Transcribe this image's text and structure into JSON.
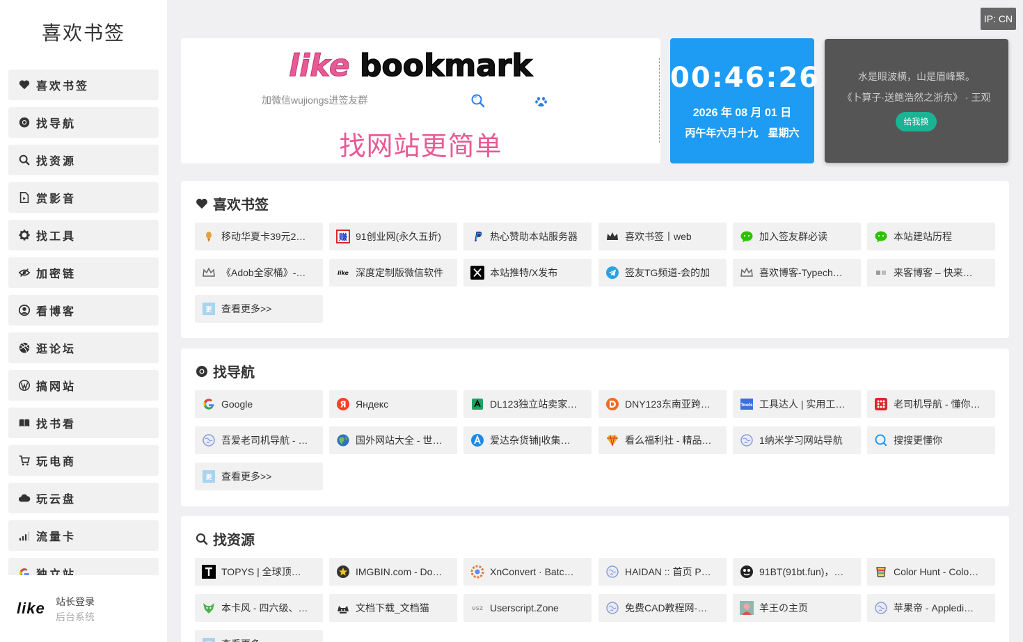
{
  "site": {
    "title": "喜欢书签",
    "logo_text": "likebookmark",
    "slogan": "找网站更简单"
  },
  "ip_badge": "IP: CN",
  "search": {
    "placeholder": "加微信wujiongs进签友群"
  },
  "clock": {
    "time": "00:46:26",
    "date": "2026 年 08 月 01 日",
    "lunar": "丙午年六月十九 星期六"
  },
  "poem": {
    "line": "水是眼波横，山是眉峰聚。",
    "source": "《卜算子·送鲍浩然之浙东》 · 王观",
    "button": "给我换"
  },
  "sidebar": {
    "items": [
      {
        "label": "喜欢书签",
        "icon": "heart-icon"
      },
      {
        "label": "找导航",
        "icon": "chrome-icon"
      },
      {
        "label": "找资源",
        "icon": "search-icon"
      },
      {
        "label": "赏影音",
        "icon": "video-file-icon"
      },
      {
        "label": "找工具",
        "icon": "gear-icon"
      },
      {
        "label": "加密链",
        "icon": "eye-slash-icon"
      },
      {
        "label": "看博客",
        "icon": "user-circle-icon"
      },
      {
        "label": "逛论坛",
        "icon": "dribbble-icon"
      },
      {
        "label": "搞网站",
        "icon": "wordpress-icon"
      },
      {
        "label": "找书看",
        "icon": "book-icon"
      },
      {
        "label": "玩电商",
        "icon": "cart-icon"
      },
      {
        "label": "玩云盘",
        "icon": "cloud-icon"
      },
      {
        "label": "流量卡",
        "icon": "signal-icon"
      },
      {
        "label": "独立站",
        "icon": "google-icon"
      }
    ],
    "footer": {
      "logo": "like",
      "login": "站长登录",
      "admin": "后台系统"
    }
  },
  "sections": [
    {
      "title": "喜欢书签",
      "icon": "heart-icon",
      "links": [
        {
          "label": "移动华夏卡39元2…",
          "icon": "gold-icon",
          "color": "#e8a23a"
        },
        {
          "label": "91创业网(永久五折)",
          "icon": "zhuan-icon",
          "color": "#d9262c"
        },
        {
          "label": "热心赞助本站服务器",
          "icon": "paypal-icon",
          "color": "#1f3c88"
        },
        {
          "label": "喜欢书签丨web",
          "icon": "crown-icon",
          "color": "#333333"
        },
        {
          "label": "加入签友群必读",
          "icon": "wechat-icon",
          "color": "#2dc100"
        },
        {
          "label": "本站建站历程",
          "icon": "wechat-icon",
          "color": "#2dc100"
        },
        {
          "label": "《Adob全家桶》-…",
          "icon": "crown-outline-icon",
          "color": "#666666"
        },
        {
          "label": "深度定制版微信软件",
          "icon": "like-icon",
          "color": "#111111"
        },
        {
          "label": "本站推特/X发布",
          "icon": "x-icon",
          "color": "#000000"
        },
        {
          "label": "签友TG频道-会的加",
          "icon": "telegram-icon",
          "color": "#2aa3e0"
        },
        {
          "label": "喜欢博客-Typech…",
          "icon": "crown-outline-icon",
          "color": "#666666"
        },
        {
          "label": "来客博客 – 快来…",
          "icon": "blog-icon",
          "color": "#999999"
        },
        {
          "label": "查看更多>>",
          "icon": "more-icon",
          "color": "#a8d4f0"
        }
      ]
    },
    {
      "title": "找导航",
      "icon": "chrome-icon",
      "links": [
        {
          "label": "Google",
          "icon": "google-icon",
          "color": "#4285f4"
        },
        {
          "label": "Яндекс",
          "icon": "yandex-icon",
          "color": "#fc3f1d"
        },
        {
          "label": "DL123独立站卖家…",
          "icon": "dl123-icon",
          "color": "#1ea362"
        },
        {
          "label": "DNY123东南亚跨…",
          "icon": "dny-icon",
          "color": "#f06a1f"
        },
        {
          "label": "工具达人 | 实用工…",
          "icon": "tools-icon",
          "color": "#3b6fe0"
        },
        {
          "label": "老司机导航 - 懂你…",
          "icon": "grid-icon",
          "color": "#d9262c"
        },
        {
          "label": "吾爱老司机导航 - …",
          "icon": "globe-icon",
          "color": "#8a9bd6"
        },
        {
          "label": "国外网站大全 - 世…",
          "icon": "earth-icon",
          "color": "#2e8b57"
        },
        {
          "label": "爱达杂货铺|收集…",
          "icon": "a-icon",
          "color": "#1e88e5"
        },
        {
          "label": "看么福利社 - 精品…",
          "icon": "diamond-icon",
          "color": "#f5a623"
        },
        {
          "label": "1纳米学习网站导航",
          "icon": "globe-icon",
          "color": "#8a9bd6"
        },
        {
          "label": "搜搜更懂你",
          "icon": "search-ring-icon",
          "color": "#2196f3"
        },
        {
          "label": "查看更多>>",
          "icon": "more-icon",
          "color": "#a8d4f0"
        }
      ]
    },
    {
      "title": "找资源",
      "icon": "search-icon",
      "links": [
        {
          "label": "TOPYS | 全球顶…",
          "icon": "t-icon",
          "color": "#000000"
        },
        {
          "label": "IMGBIN.com - Do…",
          "icon": "star-badge-icon",
          "color": "#333333"
        },
        {
          "label": "XnConvert · Batc…",
          "icon": "xn-icon",
          "color": "#e07a3a"
        },
        {
          "label": "HAIDAN :: 首页 P…",
          "icon": "globe-icon",
          "color": "#8a9bd6"
        },
        {
          "label": "91BT(91bt.fun)，…",
          "icon": "bt-icon",
          "color": "#222222"
        },
        {
          "label": "Color Hunt - Colo…",
          "icon": "cup-icon",
          "color": "#e94560"
        },
        {
          "label": "本卡风 - 四六级、…",
          "icon": "fox-icon",
          "color": "#4caf50"
        },
        {
          "label": "文档下载_文档猫",
          "icon": "cat-icon",
          "color": "#333333"
        },
        {
          "label": "Userscript.Zone",
          "icon": "usz-icon",
          "color": "#999999"
        },
        {
          "label": "免费CAD教程网-…",
          "icon": "globe-icon",
          "color": "#8a9bd6"
        },
        {
          "label": "羊王の主页",
          "icon": "avatar-icon",
          "color": "#f2a6a6"
        },
        {
          "label": "苹果帝 - Appledi…",
          "icon": "globe-icon",
          "color": "#8a9bd6"
        },
        {
          "label": "查看更多>>",
          "icon": "more-icon",
          "color": "#a8d4f0"
        }
      ]
    }
  ]
}
